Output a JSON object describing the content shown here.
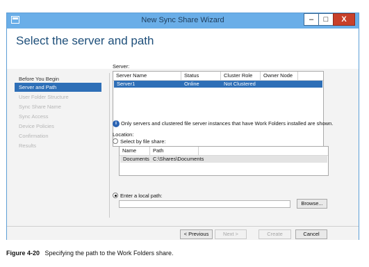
{
  "window": {
    "title": "New Sync Share Wizard",
    "minimize": "–",
    "maximize": "□",
    "close": "X"
  },
  "page_title": "Select the server and path",
  "nav": {
    "items": [
      {
        "label": "Before You Begin"
      },
      {
        "label": "Server and Path"
      },
      {
        "label": "User Folder Structure"
      },
      {
        "label": "Sync Share Name"
      },
      {
        "label": "Sync Access"
      },
      {
        "label": "Device Policies"
      },
      {
        "label": "Confirmation"
      },
      {
        "label": "Results"
      }
    ],
    "active_index": 1
  },
  "server": {
    "label": "Server:",
    "columns": [
      "Server Name",
      "Status",
      "Cluster Role",
      "Owner Node"
    ],
    "rows": [
      {
        "name": "Server1",
        "status": "Online",
        "cluster_role": "Not Clustered",
        "owner_node": ""
      }
    ],
    "selected_row": 0
  },
  "info": {
    "icon": "info-icon",
    "text": "Only servers and clustered file server instances that have Work Folders installed are shown."
  },
  "location": {
    "label": "Location:",
    "select_file_share": {
      "label": "Select by file share:",
      "selected": false
    },
    "share_columns": [
      "Name",
      "Path"
    ],
    "share_rows": [
      {
        "name": "Documents",
        "path": "C:\\Shares\\Documents"
      }
    ],
    "local_path": {
      "label": "Enter a local path:",
      "selected": true,
      "value": "",
      "browse": "Browse..."
    }
  },
  "buttons": {
    "previous": "< Previous",
    "next": "Next >",
    "create": "Create",
    "cancel": "Cancel"
  },
  "caption": {
    "figure": "Figure 4-20",
    "text": "Specifying the path to the Work Folders share."
  },
  "colors": {
    "titlebar": "#6aaee8",
    "accent": "#2e6fb7",
    "title_text": "#1e4f7a"
  }
}
